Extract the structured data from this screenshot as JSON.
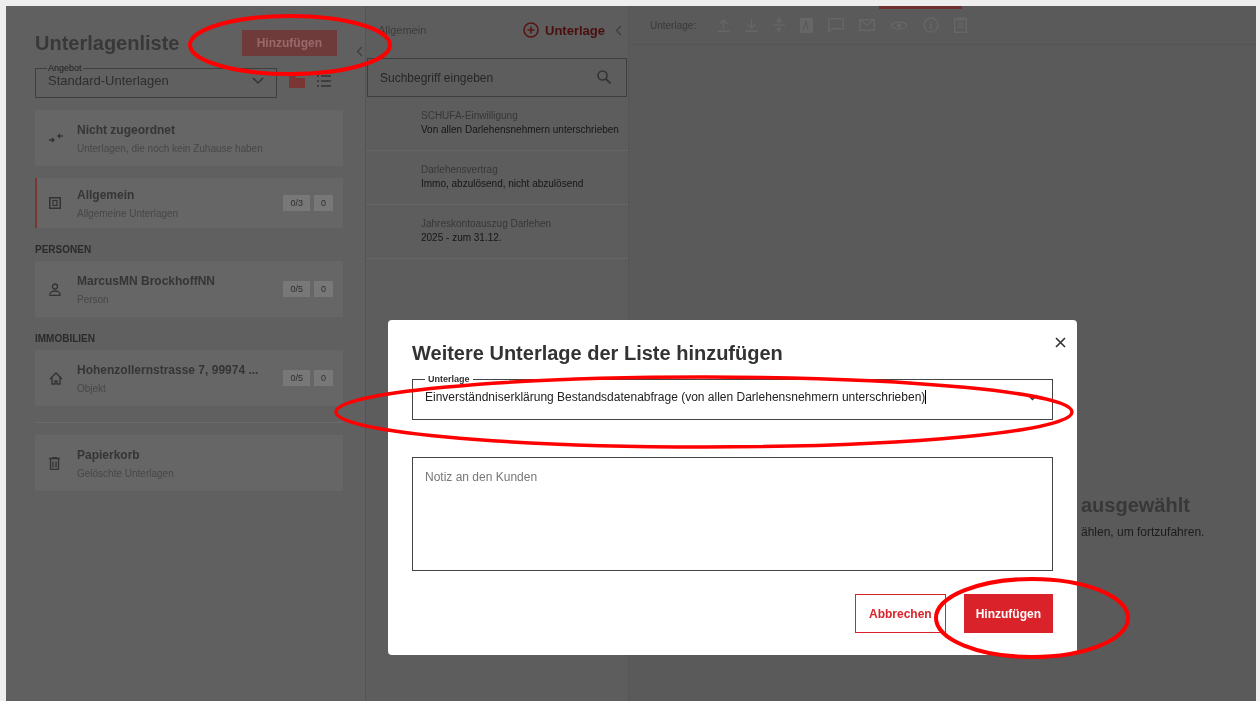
{
  "sidebar": {
    "title": "Unterlagenliste",
    "add_button": "Hinzufügen",
    "offer_select": {
      "label": "Angebot",
      "value": "Standard-Unterlagen"
    },
    "sections": [
      {
        "cards": [
          {
            "kind": "unassigned",
            "title": "Nicht zugeordnet",
            "subtitle": "Unterlagen, die noch kein Zuhause haben",
            "selected": false
          },
          {
            "kind": "general",
            "title": "Allgemein",
            "subtitle": "Allgemeine Unterlagen",
            "selected": true,
            "counts": [
              "0/3",
              "0"
            ]
          }
        ]
      },
      {
        "heading": "PERSONEN",
        "cards": [
          {
            "kind": "person",
            "title": "MarcusMN BrockhoffNN",
            "subtitle": "Person",
            "selected": false,
            "counts": [
              "0/5",
              "0"
            ]
          }
        ]
      },
      {
        "heading": "IMMOBILIEN",
        "cards": [
          {
            "kind": "property",
            "title": "Hohenzollernstrasse 7, 99974 ...",
            "subtitle": "Objekt",
            "selected": false,
            "counts": [
              "0/5",
              "0"
            ]
          }
        ]
      }
    ],
    "trash_card": {
      "title": "Papierkorb",
      "subtitle": "Gelöschte Unterlagen"
    }
  },
  "documents_panel": {
    "breadcrumb": "Allgemein",
    "add_link": "Unterlage",
    "search": {
      "placeholder": "Suchbegriff eingeben"
    },
    "documents": [
      {
        "title": "SCHUFA-Einwilligung",
        "subtitle": "Von allen Darlehensnehmern unterschrieben"
      },
      {
        "title": "Darlehensvertrag",
        "subtitle": "Immo, abzulösend, nicht abzulösend"
      },
      {
        "title": "Jahreskontoauszug Darlehen",
        "subtitle": "2025 - zum 31.12."
      }
    ]
  },
  "detail": {
    "toolbar_label": "Unterlage:",
    "empty_title": "ausgewählt",
    "empty_hint": "ählen, um fortzufahren."
  },
  "dialog": {
    "title": "Weitere Unterlage der Liste hinzufügen",
    "field": {
      "label": "Unterlage",
      "value": "Einverständniserklärung Bestandsdatenabfrage (von allen Darlehensnehmern unterschrieben)"
    },
    "note": {
      "placeholder": "Notiz an den Kunden"
    },
    "buttons": [
      {
        "kind": "secondary",
        "label": "Abbrechen"
      },
      {
        "kind": "primary",
        "label": "Hinzufügen"
      }
    ]
  }
}
